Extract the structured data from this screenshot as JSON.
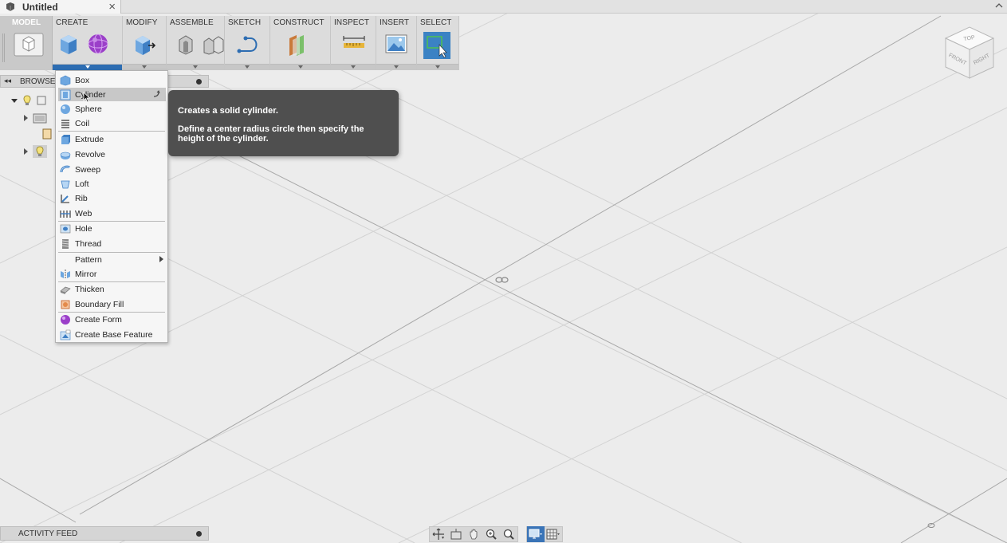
{
  "window": {
    "doc_title": "Untitled",
    "close_glyph": "×",
    "icons": {
      "doc": "fusion-doc-icon",
      "collapse": "chevron-up-icon"
    }
  },
  "toolbar": {
    "mode": {
      "label": "MODEL",
      "icon": "model-workspace-icon"
    },
    "groups": [
      {
        "label": "CREATE",
        "icons": [
          "box-icon",
          "create-form-icon"
        ]
      },
      {
        "label": "MODIFY",
        "icons": [
          "press-pull-icon"
        ]
      },
      {
        "label": "ASSEMBLE",
        "icons": [
          "new-component-icon",
          "joint-icon"
        ]
      },
      {
        "label": "SKETCH",
        "icons": [
          "sketch-spline-icon"
        ]
      },
      {
        "label": "CONSTRUCT",
        "icons": [
          "offset-plane-icon"
        ]
      },
      {
        "label": "INSPECT",
        "icons": [
          "measure-icon"
        ]
      },
      {
        "label": "INSERT",
        "icons": [
          "insert-image-icon"
        ]
      },
      {
        "label": "SELECT",
        "icons": [
          "select-icon"
        ]
      }
    ]
  },
  "browser": {
    "label": "BROWSER",
    "collapse_glyph": "◂◂"
  },
  "create_menu": {
    "items": [
      {
        "label": "Box",
        "icon": "box-icon"
      },
      {
        "label": "Cylinder",
        "icon": "cylinder-icon",
        "highlighted": true
      },
      {
        "label": "Sphere",
        "icon": "sphere-icon"
      },
      {
        "label": "Coil",
        "icon": "coil-icon"
      },
      {
        "label": "Extrude",
        "icon": "extrude-icon"
      },
      {
        "label": "Revolve",
        "icon": "revolve-icon"
      },
      {
        "label": "Sweep",
        "icon": "sweep-icon"
      },
      {
        "label": "Loft",
        "icon": "loft-icon"
      },
      {
        "label": "Rib",
        "icon": "rib-icon"
      },
      {
        "label": "Web",
        "icon": "web-icon"
      },
      {
        "label": "Hole",
        "icon": "hole-icon"
      },
      {
        "label": "Thread",
        "icon": "thread-icon"
      },
      {
        "label": "Pattern",
        "icon": "",
        "submenu": true
      },
      {
        "label": "Mirror",
        "icon": "mirror-icon"
      },
      {
        "label": "Thicken",
        "icon": "thicken-icon"
      },
      {
        "label": "Boundary Fill",
        "icon": "boundary-fill-icon"
      },
      {
        "label": "Create Form",
        "icon": "create-form-icon"
      },
      {
        "label": "Create Base Feature",
        "icon": "create-base-feature-icon"
      }
    ]
  },
  "tooltip": {
    "title": "Creates a solid cylinder.",
    "body": "Define a center radius circle then specify the height of the cylinder."
  },
  "viewcube": {
    "top": "TOP",
    "front": "FRONT",
    "right": "RIGHT"
  },
  "activity_feed": {
    "label": "ACTIVITY FEED"
  },
  "navbar": {
    "icons": [
      "orbit-icon",
      "look-at-icon",
      "pan-icon",
      "zoom-icon",
      "zoom-window-icon",
      "display-settings-icon",
      "grid-settings-icon"
    ]
  }
}
